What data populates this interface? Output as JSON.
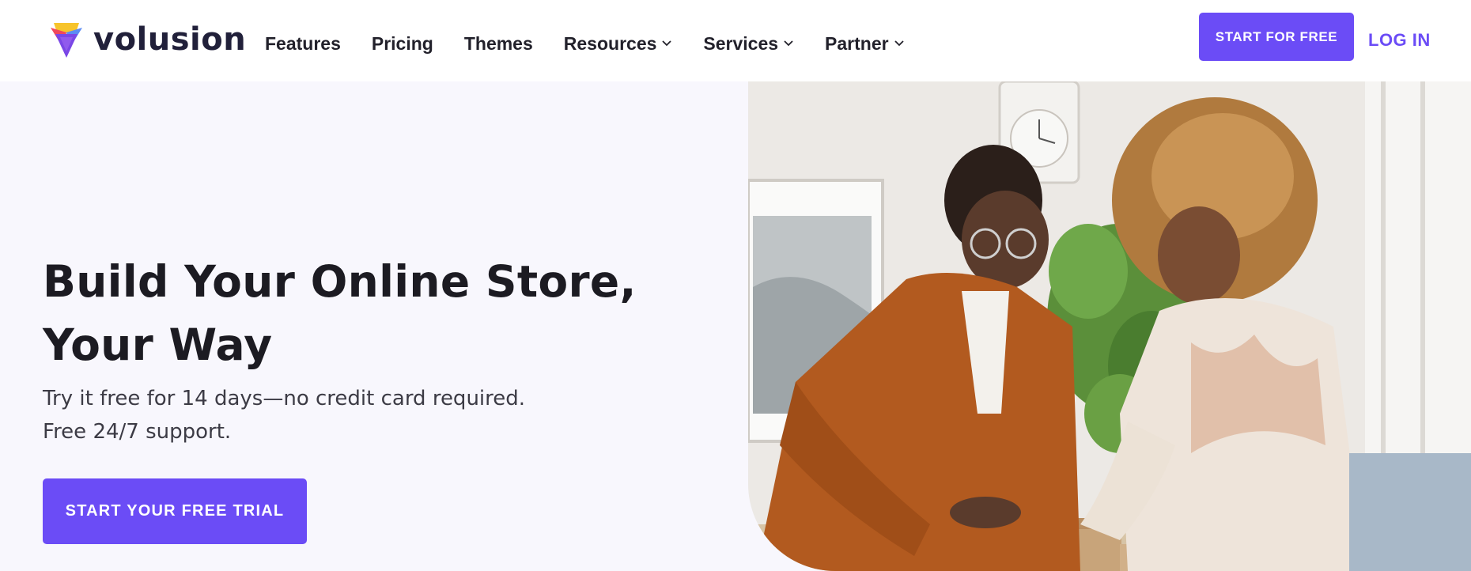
{
  "brand": {
    "name": "volusion",
    "logo_colors": [
      "#f7c42b",
      "#f0485c",
      "#7a47e6",
      "#5b8bf4"
    ]
  },
  "nav": {
    "items": [
      {
        "label": "Features",
        "dropdown": false
      },
      {
        "label": "Pricing",
        "dropdown": false
      },
      {
        "label": "Themes",
        "dropdown": false
      },
      {
        "label": "Resources",
        "dropdown": true
      },
      {
        "label": "Services",
        "dropdown": true
      },
      {
        "label": "Partner",
        "dropdown": true
      }
    ]
  },
  "header": {
    "cta_label": "START FOR FREE",
    "login_label": "LOG IN"
  },
  "hero": {
    "title_line1": "Build Your Online Store,",
    "title_line2": "Your Way",
    "subtitle_line1": "Try it free for 14 days—no credit card required.",
    "subtitle_line2": "Free 24/7 support.",
    "cta_label": "START YOUR FREE TRIAL",
    "image_subject": "two people packing cardboard boxes"
  },
  "colors": {
    "accent": "#6b4cf6",
    "hero_bg": "#f8f7fd",
    "text_dark": "#1c1b22"
  },
  "icons": {
    "dropdown": "chevron-down-icon"
  }
}
